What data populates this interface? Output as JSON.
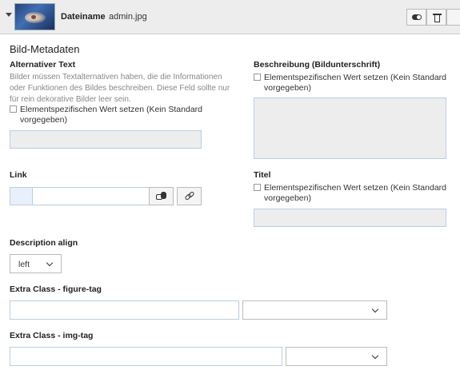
{
  "header": {
    "filename_label": "Dateiname",
    "filename_value": "admin.jpg",
    "toggle_icon": "toggle-icon",
    "delete_icon": "trash-icon"
  },
  "section": {
    "title": "Bild-Metadaten"
  },
  "alt_text": {
    "label": "Alternativer Text",
    "description_lines": [
      "Bilder müssen Textalternativen haben, die die Informationen",
      "oder Funktionen des Bildes beschreiben. Diese Feld sollte nur",
      "für rein dekorative Bilder leer sein."
    ],
    "checkbox_line1": "Elementspezifischen Wert setzen (Kein Standard",
    "checkbox_line2": "vorgegeben)",
    "value": ""
  },
  "caption": {
    "label": "Beschreibung (Bildunterschrift)",
    "checkbox_line1": "Elementspezifischen Wert setzen (Kein Standard",
    "checkbox_line2": "vorgegeben)",
    "value": ""
  },
  "link": {
    "label": "Link",
    "value": "",
    "wizard_icon": "link-wizard-icon",
    "chain_icon": "chain-link-icon"
  },
  "title": {
    "label": "Titel",
    "checkbox_line1": "Elementspezifischen Wert setzen (Kein Standard",
    "checkbox_line2": "vorgegeben)",
    "value": ""
  },
  "description_align": {
    "label": "Description align",
    "selected": "left"
  },
  "figure_class": {
    "label": "Extra Class - figure-tag",
    "value": "",
    "selected": ""
  },
  "img_class": {
    "label": "Extra Class - img-tag",
    "value": "",
    "selected": ""
  },
  "colors": {
    "header_bg": "#ededed",
    "input_border": "#b9cde6",
    "disabled_bg": "#ededed"
  }
}
